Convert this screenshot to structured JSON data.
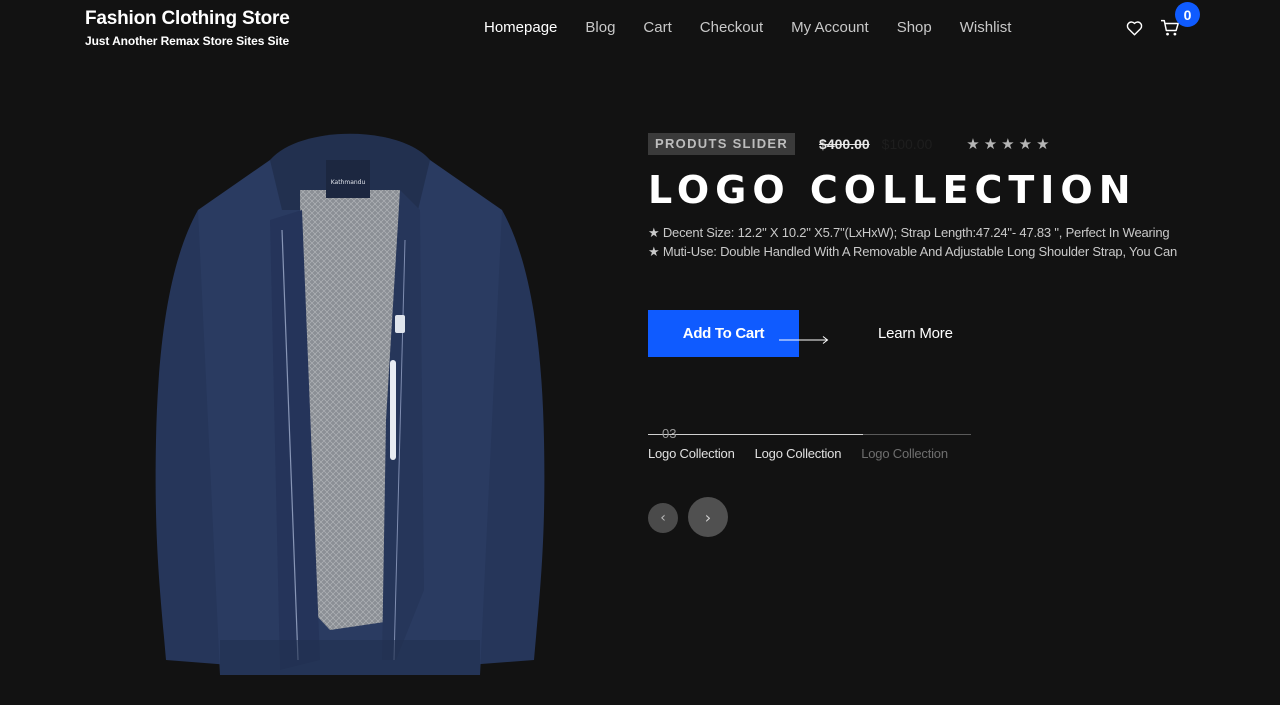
{
  "brand": {
    "title": "Fashion Clothing Store",
    "tagline": "Just Another Remax Store Sites Site"
  },
  "nav": {
    "items": [
      {
        "label": "Homepage",
        "active": true
      },
      {
        "label": "Blog"
      },
      {
        "label": "Cart"
      },
      {
        "label": "Checkout"
      },
      {
        "label": "My Account"
      },
      {
        "label": "Shop"
      },
      {
        "label": "Wishlist"
      }
    ]
  },
  "header_icons": {
    "wishlist_icon": "heart-icon",
    "cart_icon": "cart-icon",
    "cart_count": "0"
  },
  "product": {
    "image_icon": "jacket-image",
    "jacket_brand_label": "Kathmandu",
    "badge": "PRODUTS SLIDER",
    "price_old": "$400.00",
    "price_new": "$100.00",
    "rating": 5,
    "title": "LOGO COLLECTION",
    "features": [
      "★ Decent Size: 12.2\" X 10.2\" X5.7\"(LxHxW); Strap Length:47.24\"- 47.83 \", Perfect In Wearing",
      "★ Muti-Use: Double Handled With A Removable And Adjustable Long Shoulder Strap, You Can"
    ],
    "add_to_cart_label": "Add To Cart",
    "learn_more_label": "Learn More"
  },
  "slider": {
    "slide_number": "03",
    "progress": 0.667,
    "thumbs": [
      "Logo Collection",
      "Logo Collection",
      "Logo Collection"
    ],
    "prev_label": "‹",
    "next_label": "›"
  },
  "colors": {
    "background": "#121212",
    "accent": "#0f5bff",
    "jacket": "#26365a"
  }
}
